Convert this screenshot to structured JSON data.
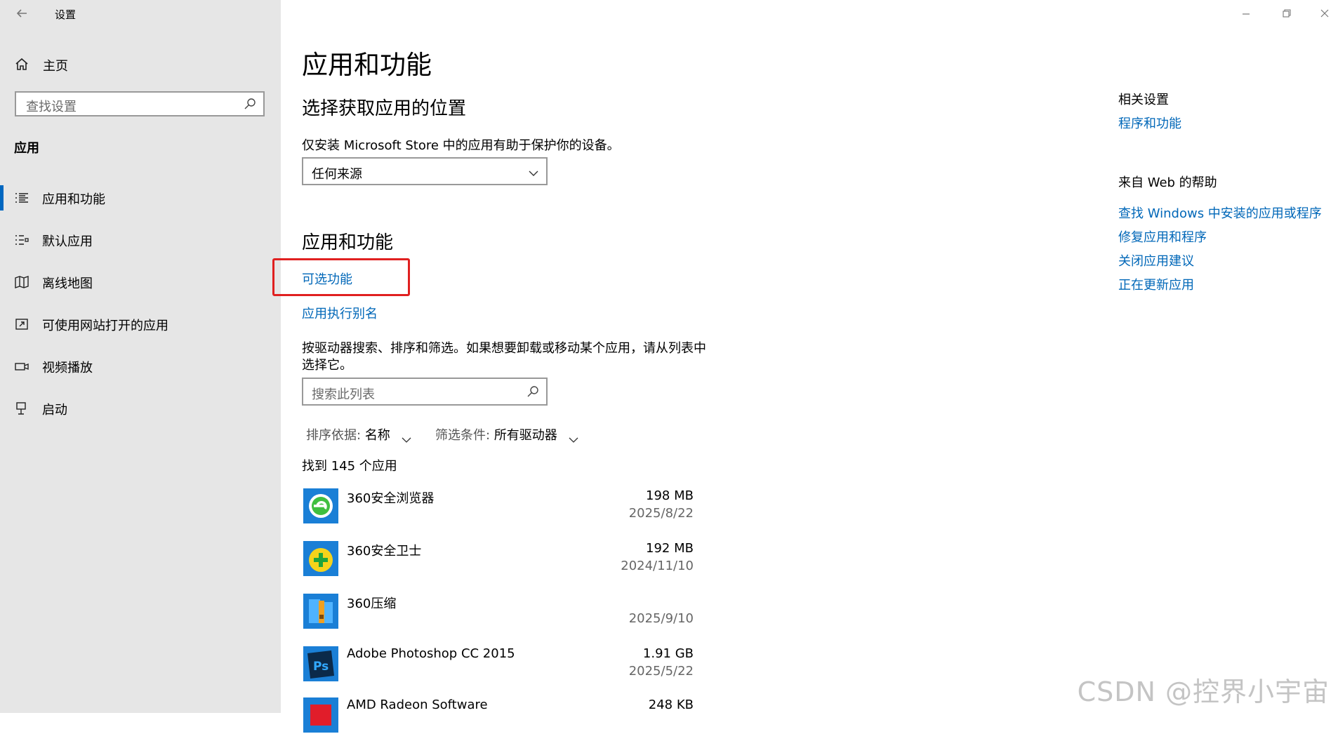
{
  "window": {
    "title": "设置",
    "controls": [
      "minimize-icon",
      "restore-icon",
      "close-icon"
    ]
  },
  "sidebar": {
    "home_label": "主页",
    "search_placeholder": "查找设置",
    "section_title": "应用",
    "items": [
      {
        "label": "应用和功能",
        "icon": "list-icon",
        "active": true
      },
      {
        "label": "默认应用",
        "icon": "default-apps-icon",
        "active": false
      },
      {
        "label": "离线地图",
        "icon": "map-icon",
        "active": false
      },
      {
        "label": "可使用网站打开的应用",
        "icon": "open-with-icon",
        "active": false
      },
      {
        "label": "视频播放",
        "icon": "video-icon",
        "active": false
      },
      {
        "label": "启动",
        "icon": "startup-icon",
        "active": false
      }
    ]
  },
  "main": {
    "page_title": "应用和功能",
    "choose_location_title": "选择获取应用的位置",
    "choose_location_desc": "仅安装 Microsoft Store 中的应用有助于保护你的设备。",
    "source_dropdown_value": "任何来源",
    "apps_features_title": "应用和功能",
    "optional_features_link": "可选功能",
    "app_alias_link": "应用执行别名",
    "list_desc_line1": "按驱动器搜索、排序和筛选。如果想要卸载或移动某个应用，请从列表中",
    "list_desc_line2": "选择它。",
    "list_search_placeholder": "搜索此列表",
    "sort_key": "排序依据:",
    "sort_value": "名称",
    "filter_key": "筛选条件:",
    "filter_value": "所有驱动器",
    "count_text": "找到 145 个应用",
    "apps": [
      {
        "name": "360安全浏览器",
        "size": "198 MB",
        "date": "2025/8/22",
        "icon": "360-browser-icon",
        "color": "#1a7fd6"
      },
      {
        "name": "360安全卫士",
        "size": "192 MB",
        "date": "2024/11/10",
        "icon": "360-safeguard-icon",
        "color": "#1a7fd6"
      },
      {
        "name": "360压缩",
        "size": "",
        "date": "2025/9/10",
        "icon": "360-zip-icon",
        "color": "#1a7fd6"
      },
      {
        "name": "Adobe Photoshop CC 2015",
        "size": "1.91 GB",
        "date": "2025/5/22",
        "icon": "photoshop-icon",
        "color": "#0b2a4a"
      },
      {
        "name": "AMD Radeon Software",
        "size": "248 KB",
        "date": "",
        "icon": "amd-icon",
        "color": "#e11d2a"
      }
    ]
  },
  "related": {
    "related_title": "相关设置",
    "related_links": [
      "程序和功能"
    ],
    "help_title": "来自 Web 的帮助",
    "help_links": [
      "查找 Windows 中安装的应用或程序",
      "修复应用和程序",
      "关闭应用建议",
      "正在更新应用"
    ]
  },
  "watermark": "CSDN @控界小宇宙",
  "colors": {
    "accent": "#0067b8",
    "highlight": "#e02020",
    "sidebar_bg": "#e6e6e6"
  }
}
